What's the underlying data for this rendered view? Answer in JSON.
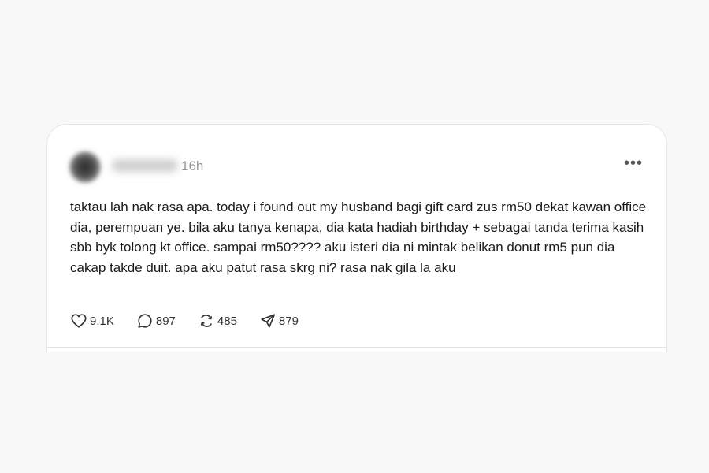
{
  "post": {
    "timestamp": "16h",
    "more_label": "•••",
    "text": "taktau lah nak rasa apa. today i found out my husband bagi gift card zus rm50 dekat kawan office dia, perempuan ye. bila aku tanya kenapa, dia kata hadiah birthday + sebagai tanda terima kasih sbb byk tolong kt office. sampai rm50???? aku isteri dia ni mintak belikan donut rm5 pun dia cakap takde duit. apa aku patut rasa skrg ni? rasa nak gila la aku"
  },
  "actions": {
    "likes": "9.1K",
    "replies": "897",
    "reposts": "485",
    "shares": "879"
  },
  "icons": {
    "like": "heart-icon",
    "reply": "comment-icon",
    "repost": "repost-icon",
    "share": "send-icon",
    "more": "more-icon"
  }
}
